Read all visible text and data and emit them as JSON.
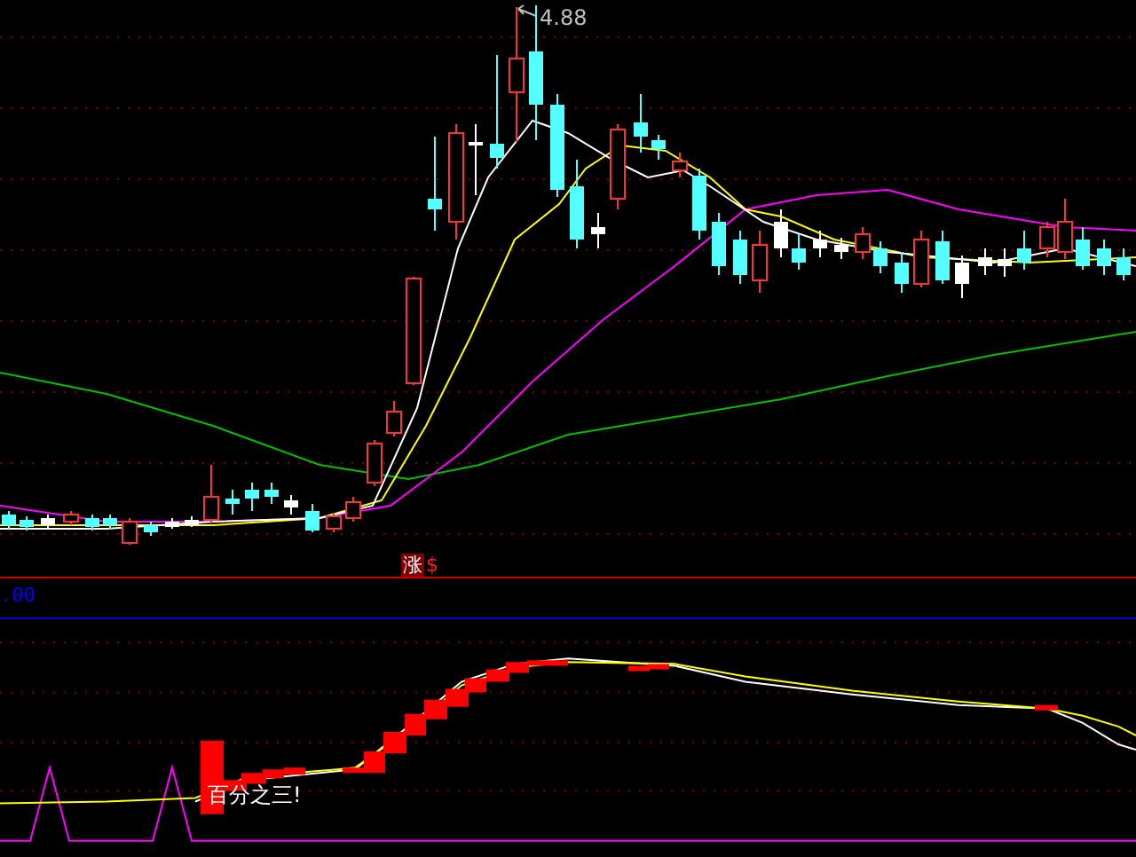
{
  "price_chart": {
    "high_label": "4.88",
    "signal_badge": "涨",
    "signal_mark": "$"
  },
  "indicator_pane": {
    "axis_value": ".00",
    "annotation": "百分之三!"
  }
}
